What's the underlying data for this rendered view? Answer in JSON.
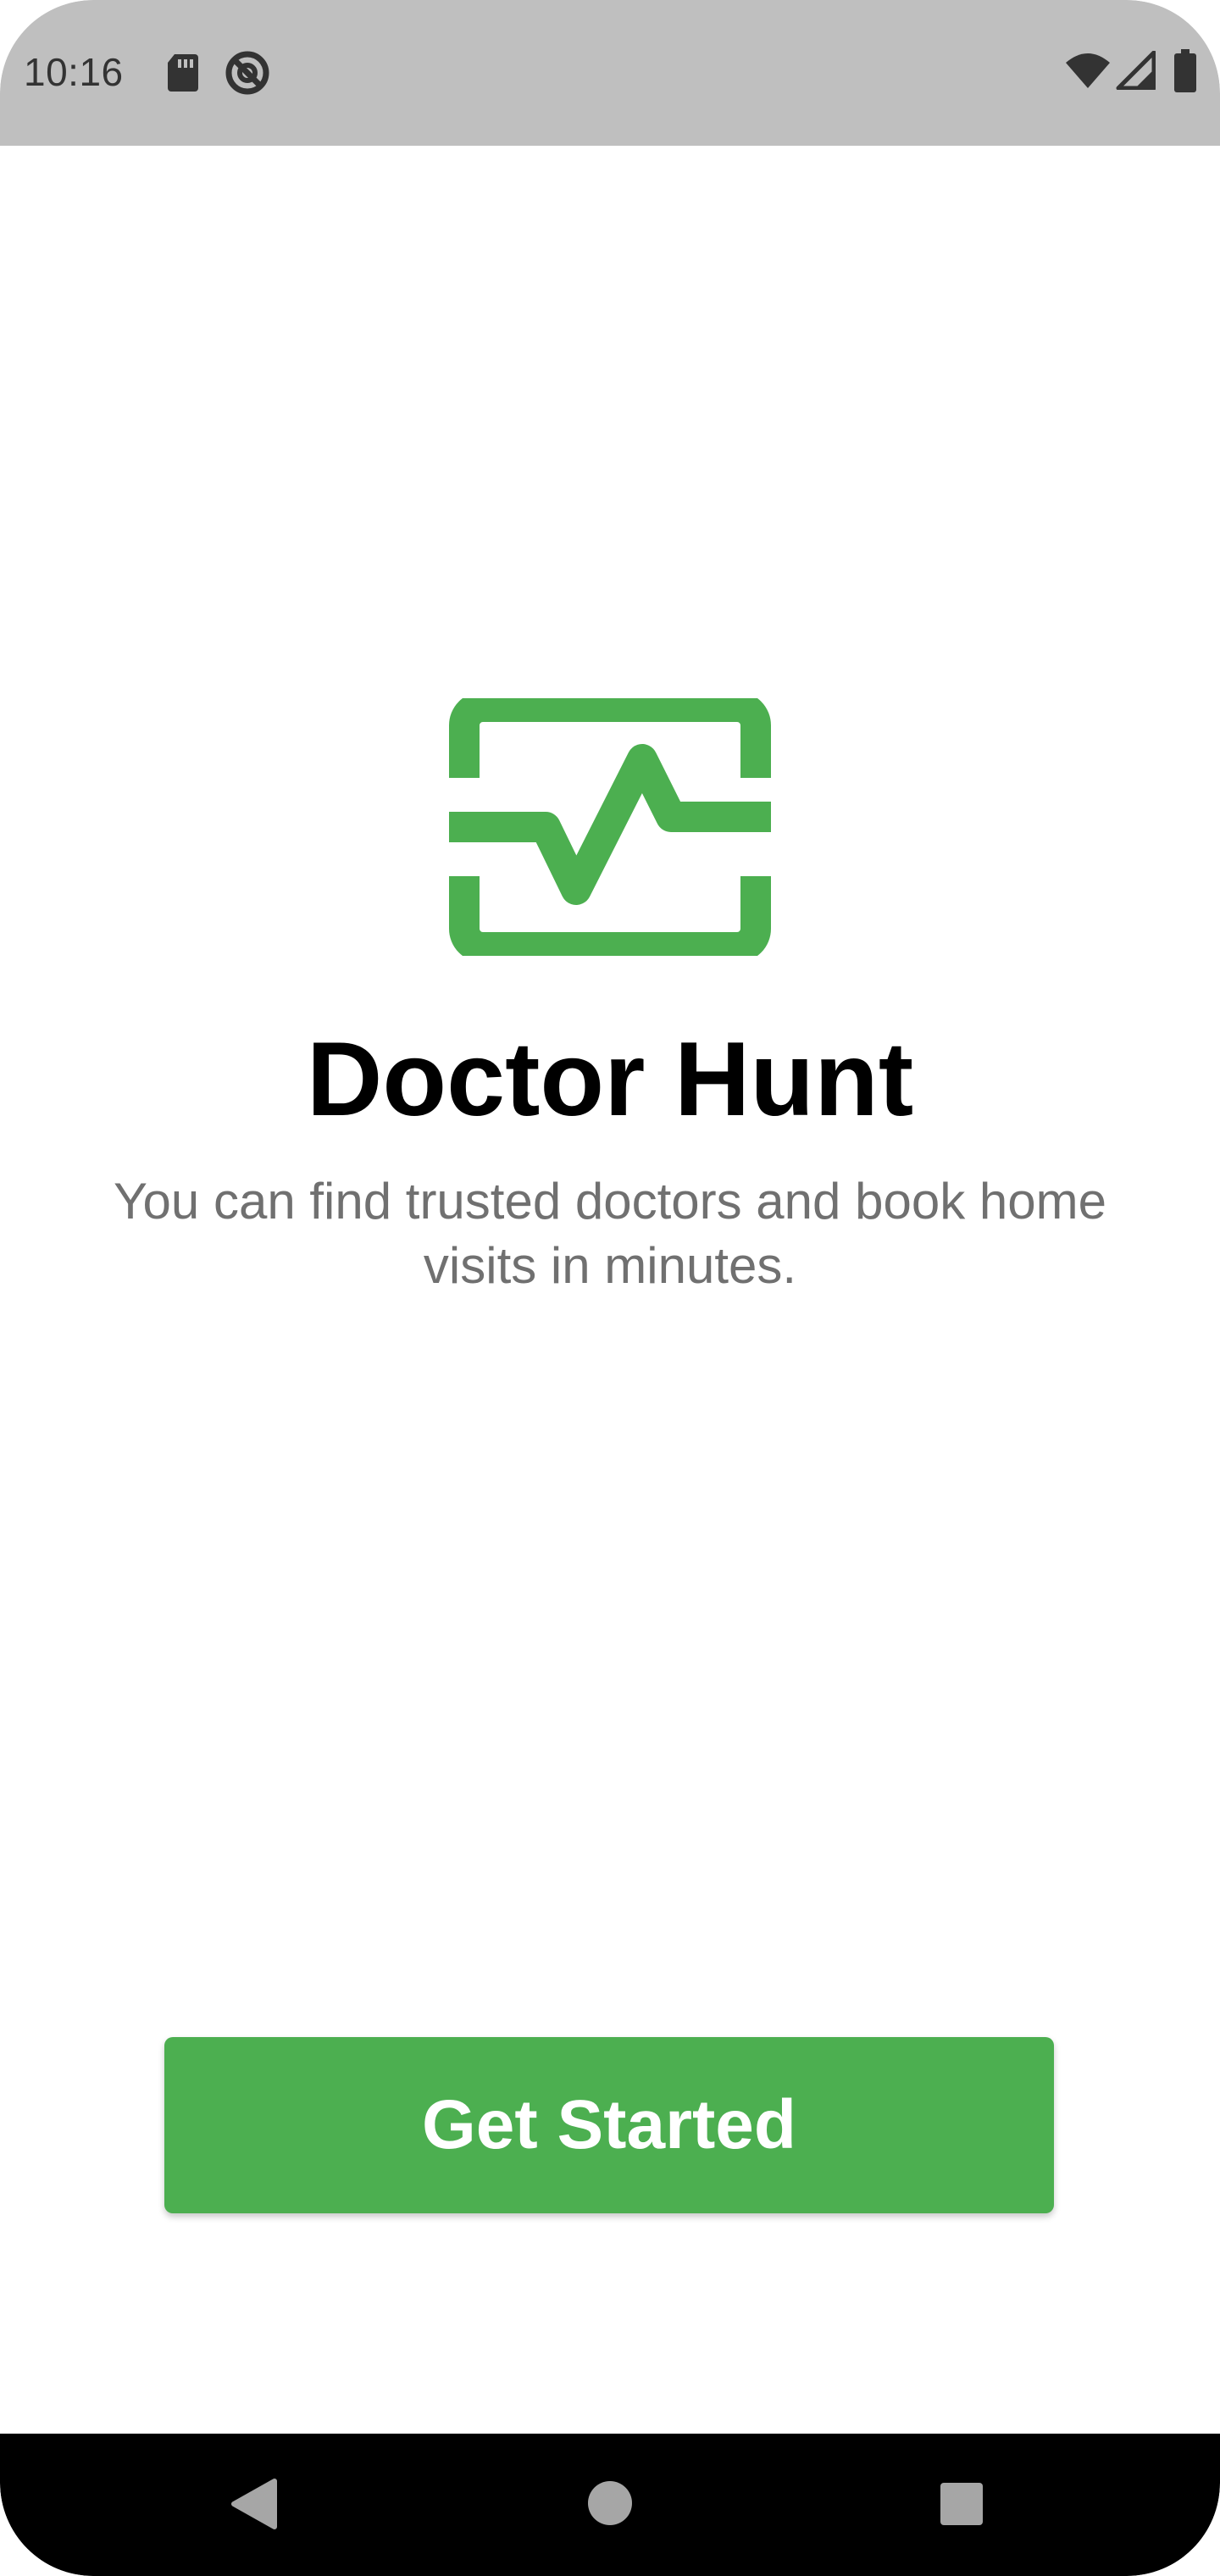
{
  "status_bar": {
    "time": "10:16",
    "left_icons": [
      "sd-card-icon",
      "no-sync-icon"
    ],
    "right_icons": [
      "wifi-icon",
      "cell-signal-icon",
      "battery-icon"
    ]
  },
  "splash": {
    "logo_icon": "heart-monitor-icon",
    "title": "Doctor Hunt",
    "tagline": "You can find trusted doctors and book home visits in minutes.",
    "cta_label": "Get Started"
  },
  "nav_bar": {
    "buttons": [
      "back-icon",
      "home-icon",
      "recents-icon"
    ]
  },
  "colors": {
    "accent": "#4caf50",
    "status_bar_bg": "#bfbfbf",
    "nav_bar_bg": "#000000",
    "title": "#000000",
    "tagline": "#707070"
  }
}
